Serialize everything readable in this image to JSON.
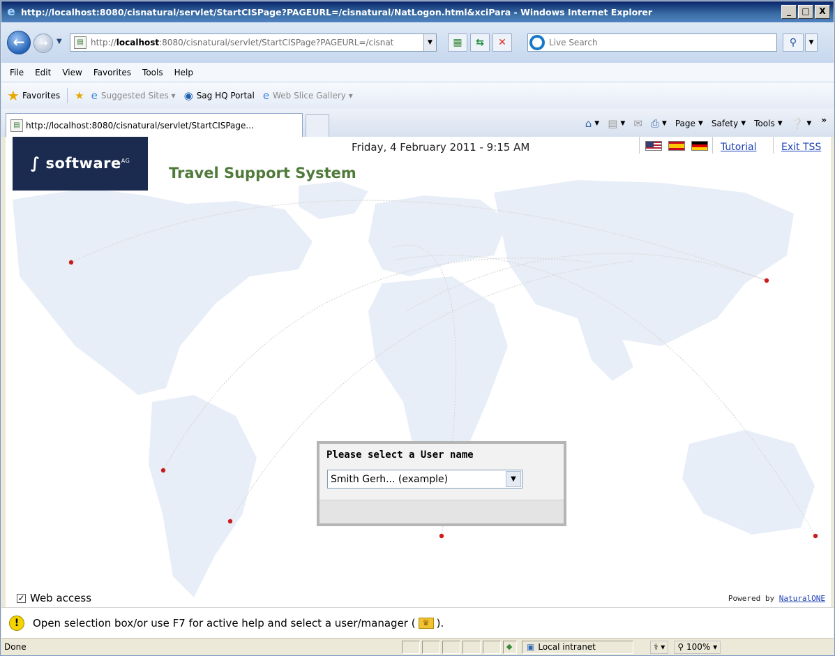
{
  "window": {
    "title": "http://localhost:8080/cisnatural/servlet/StartCISPage?PAGEURL=/cisnatural/NatLogon.html&xciPara - Windows Internet Explorer",
    "controls": {
      "minimize": "_",
      "maximize": "□",
      "close": "X"
    }
  },
  "address": {
    "url_host": "localhost",
    "url_prefix": "http://",
    "url_rest": ":8080/cisnatural/servlet/StartCISPage?PAGEURL=/cisnat",
    "search_placeholder": "Live Search"
  },
  "menu": [
    "File",
    "Edit",
    "View",
    "Favorites",
    "Tools",
    "Help"
  ],
  "favorites": {
    "label": "Favorites",
    "items": [
      {
        "label": "Suggested Sites ▾"
      },
      {
        "label": "Sag HQ Portal"
      },
      {
        "label": "Web Slice Gallery ▾"
      }
    ]
  },
  "tab": {
    "label": "http://localhost:8080/cisnatural/servlet/StartCISPage..."
  },
  "commandbar": {
    "page": "Page",
    "safety": "Safety",
    "tools": "Tools",
    "more": "»"
  },
  "page": {
    "brand": "software",
    "brand_sup": "AG",
    "app_title": "Travel Support System",
    "datetime": "Friday,  4 February 2011 - 9:15 AM",
    "tutorial_link": "Tutorial",
    "exit_link": "Exit TSS",
    "select_panel": {
      "title": "Please select a User name",
      "selected_value": "Smith Gerh... (example)"
    },
    "web_access_label": "Web access",
    "powered_prefix": "Powered by ",
    "powered_link": "NaturalONE"
  },
  "help": {
    "before": "Open selection box/or use F7 for active help and select a user/manager (",
    "after": ")."
  },
  "status": {
    "text": "Done",
    "zone": "Local intranet",
    "zoom": "100%"
  }
}
